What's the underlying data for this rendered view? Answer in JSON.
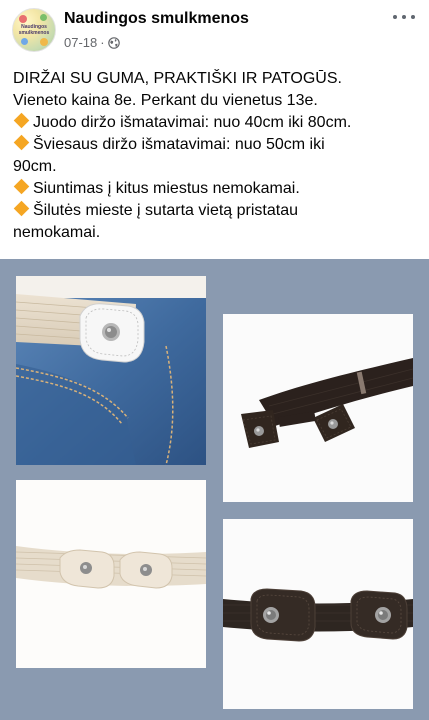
{
  "header": {
    "page_name": "Naudingos smulkmenos",
    "date": "07-18",
    "separator": "·",
    "avatar_text": "Naudingos smulkmenos",
    "privacy_icon": "globe-icon",
    "menu_icon": "more-horizontal-icon"
  },
  "post": {
    "line1": "DIRŽAI SU GUMA, PRAKTIŠKI IR PATOGŪS.",
    "line2": "Vieneto kaina 8e. Perkant du vienetus 13e.",
    "item1": "Juodo diržo išmatavimai: nuo 40cm iki 80cm.",
    "item2a": "Šviesaus diržo išmatavimai: nuo 50cm iki",
    "item2b": "90cm.",
    "item3": "Siuntimas į kitus miestus nemokamai.",
    "item4a": "Šilutės mieste į sutarta vietą pristatau",
    "item4b": "nemokamai.",
    "bullet_icon": "orange-diamond-icon",
    "bullet_color": "#f5a623"
  },
  "photos": [
    {
      "name": "beige-belt-on-jeans-photo"
    },
    {
      "name": "black-belt-photo"
    },
    {
      "name": "beige-belt-closeup-photo"
    },
    {
      "name": "black-belt-closeup-photo"
    }
  ],
  "colors": {
    "grid_background": "#8a9ab0",
    "text": "#050505",
    "meta_text": "#65676b"
  }
}
